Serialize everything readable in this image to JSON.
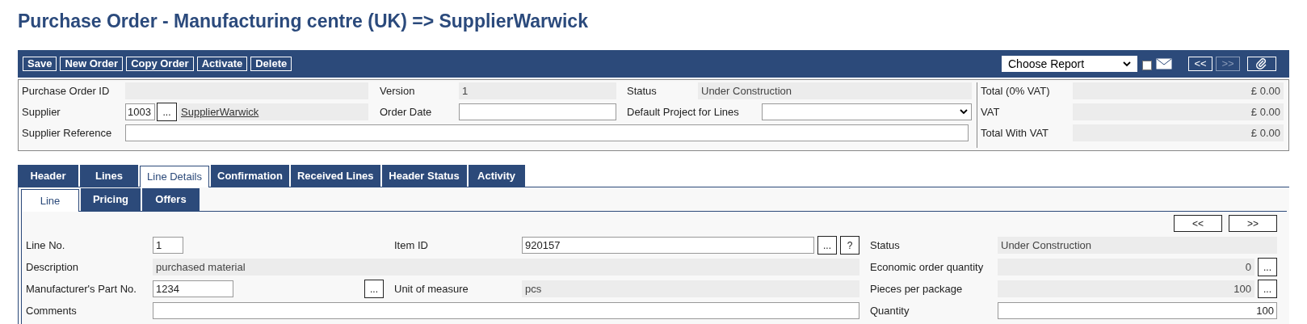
{
  "title": "Purchase Order - Manufacturing centre (UK) => SupplierWarwick",
  "toolbar": {
    "buttons": [
      "Save",
      "New Order",
      "Copy Order",
      "Activate",
      "Delete"
    ],
    "report_select": {
      "value": "Choose Report"
    },
    "email_checkbox": {
      "checked": false
    },
    "nav": [
      {
        "label": "<<",
        "disabled": false
      },
      {
        "label": ">>",
        "disabled": true
      }
    ]
  },
  "header": {
    "rows": [
      [
        {
          "label": "Purchase Order ID",
          "kind": "readonly"
        },
        {
          "label": "Version",
          "kind": "readonly",
          "value": "1"
        },
        {
          "label": "Status",
          "kind": "readonly",
          "value": "Under Construction"
        }
      ],
      [
        {
          "label": "Supplier",
          "kind": "lookup",
          "code": "1003",
          "button": "...",
          "link": "SupplierWarwick"
        },
        {
          "label": "Order Date",
          "kind": "input"
        },
        {
          "label": "Default Project for Lines",
          "kind": "select"
        }
      ],
      [
        {
          "label": "Supplier Reference",
          "kind": "input"
        }
      ]
    ],
    "totals": [
      {
        "label": "Total (0% VAT)",
        "value": "£ 0.00"
      },
      {
        "label": "VAT",
        "value": "£ 0.00"
      },
      {
        "label": "Total With VAT",
        "value": "£ 0.00"
      }
    ]
  },
  "tabs": [
    {
      "label": "Header",
      "selected": false
    },
    {
      "label": "Lines",
      "selected": false
    },
    {
      "label": "Line Details",
      "selected": true
    },
    {
      "label": "Confirmation",
      "selected": false
    },
    {
      "label": "Received Lines",
      "selected": false
    },
    {
      "label": "Header Status",
      "selected": false
    },
    {
      "label": "Activity",
      "selected": false
    }
  ],
  "subtabs": [
    {
      "label": "Line",
      "selected": true
    },
    {
      "label": "Pricing",
      "selected": false
    },
    {
      "label": "Offers",
      "selected": false
    }
  ],
  "line": {
    "nav": [
      "<<",
      ">>"
    ],
    "rows": [
      [
        {
          "label": "Line No.",
          "kind": "input",
          "value": "1"
        },
        {
          "label": "Item ID",
          "kind": "input",
          "value": "920157",
          "buttons": [
            "...",
            "?"
          ]
        },
        {
          "label": "Status",
          "kind": "readonly",
          "value": "Under Construction"
        }
      ],
      [
        {
          "label": "Description",
          "kind": "readonly",
          "value": "purchased material"
        },
        {
          "label": "Economic order quantity",
          "kind": "readonly",
          "value": "0",
          "numeric": true,
          "buttons": [
            "..."
          ]
        }
      ],
      [
        {
          "label": "Manufacturer's Part No.",
          "kind": "input",
          "value": "1234",
          "buttons": [
            "..."
          ]
        },
        {
          "label": "Unit of measure",
          "kind": "readonly",
          "value": "pcs"
        },
        {
          "label": "Pieces per package",
          "kind": "readonly",
          "value": "100",
          "numeric": true,
          "buttons": [
            "..."
          ]
        }
      ],
      [
        {
          "label": "Comments",
          "kind": "input"
        },
        {
          "label": "Quantity",
          "kind": "input",
          "value": "100",
          "numeric": true
        }
      ]
    ]
  }
}
